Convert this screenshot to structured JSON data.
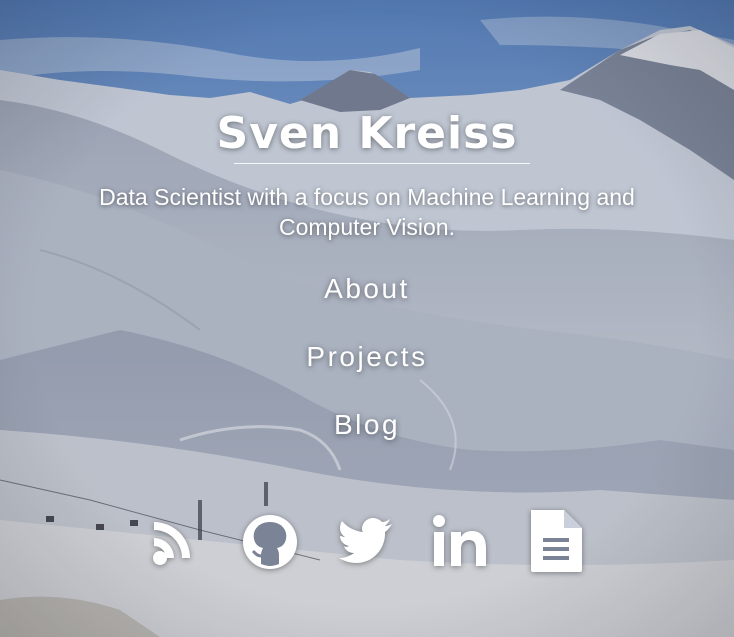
{
  "header": {
    "name": "Sven Kreiss",
    "tagline": "Data Scientist with a focus on Machine Learning and Computer Vision."
  },
  "nav": {
    "about": "About",
    "projects": "Projects",
    "blog": "Blog"
  },
  "social": {
    "icons": [
      "rss-icon",
      "github-icon",
      "twitter-icon",
      "linkedin-icon",
      "document-icon"
    ]
  },
  "colors": {
    "text": "#ffffff",
    "sky": "#7ea3cf",
    "snow": "#e9edf3",
    "shadow": "#8a93a6"
  }
}
